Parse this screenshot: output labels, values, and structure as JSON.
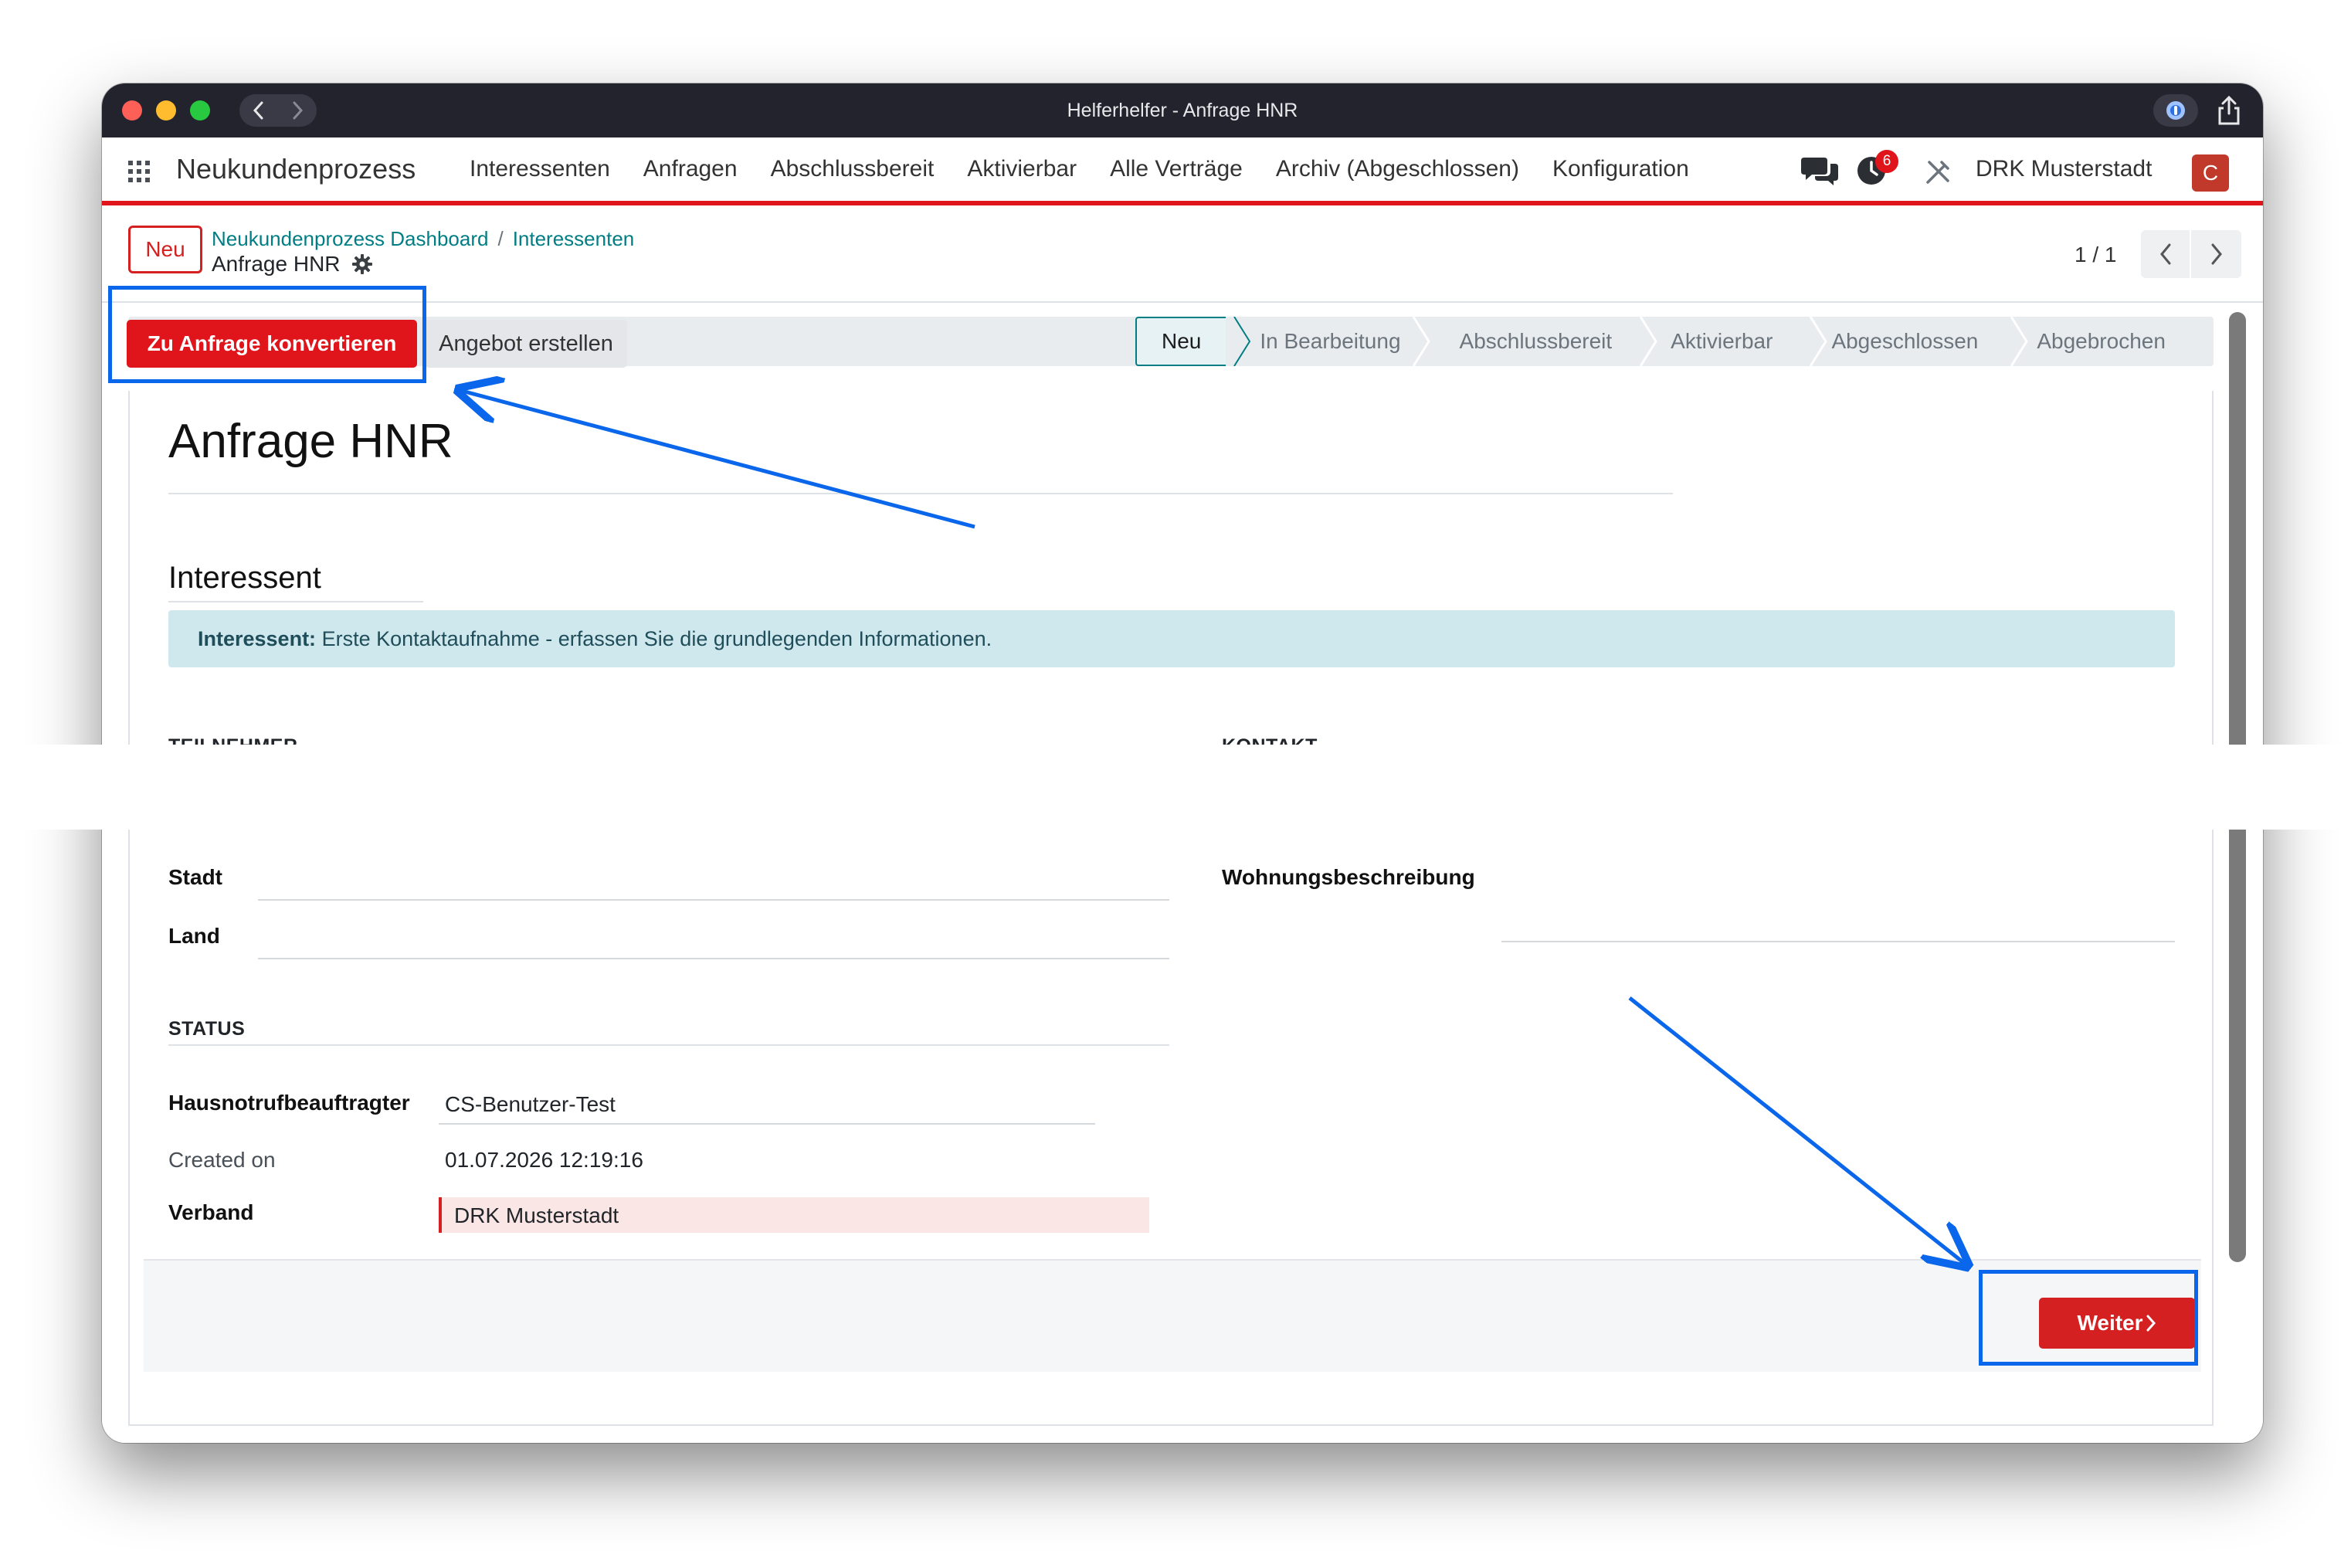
{
  "window": {
    "title": "Helferhelfer - Anfrage HNR"
  },
  "topnav": {
    "brand": "Neukundenprozess",
    "menu": [
      "Interessenten",
      "Anfragen",
      "Abschlussbereit",
      "Aktivierbar",
      "Alle Verträge",
      "Archiv (Abgeschlossen)",
      "Konfiguration"
    ],
    "activity_badge": "6",
    "company": "DRK Musterstadt",
    "avatar_letter": "C"
  },
  "control_panel": {
    "new_label": "Neu",
    "breadcrumb": [
      "Neukundenprozess Dashboard",
      "Interessenten"
    ],
    "breadcrumb_sep": "/",
    "current": "Anfrage HNR",
    "pager": "1 / 1"
  },
  "actions": {
    "convert_label": "Zu Anfrage konvertieren",
    "offer_label": "Angebot erstellen"
  },
  "stages": [
    "Neu",
    "In Bearbeitung",
    "Abschlussbereit",
    "Aktivierbar",
    "Abgeschlossen",
    "Abgebrochen"
  ],
  "active_stage": "Neu",
  "form": {
    "title": "Anfrage HNR",
    "section": "Interessent",
    "alert_bold": "Interessent:",
    "alert_text": " Erste Kontaktaufnahme - erfassen Sie die grundlegenden Informationen.",
    "group_teilnehmer": "TEILNEHMER",
    "group_kontakt": "KONTAKT",
    "label_stadt": "Stadt",
    "label_land": "Land",
    "label_wohnung": "Wohnungsbeschreibung",
    "group_status": "STATUS",
    "label_beauftragter": "Hausnotrufbeauftragter",
    "value_beauftragter": "CS-Benutzer-Test",
    "label_created": "Created on",
    "value_created": "01.07.2026 12:19:16",
    "label_verband": "Verband",
    "value_verband": "DRK Musterstadt",
    "next_label": "Weiter"
  },
  "colors": {
    "brand_red": "#e0151b",
    "teal_link": "#017e84",
    "annotation_blue": "#0a66ea"
  }
}
